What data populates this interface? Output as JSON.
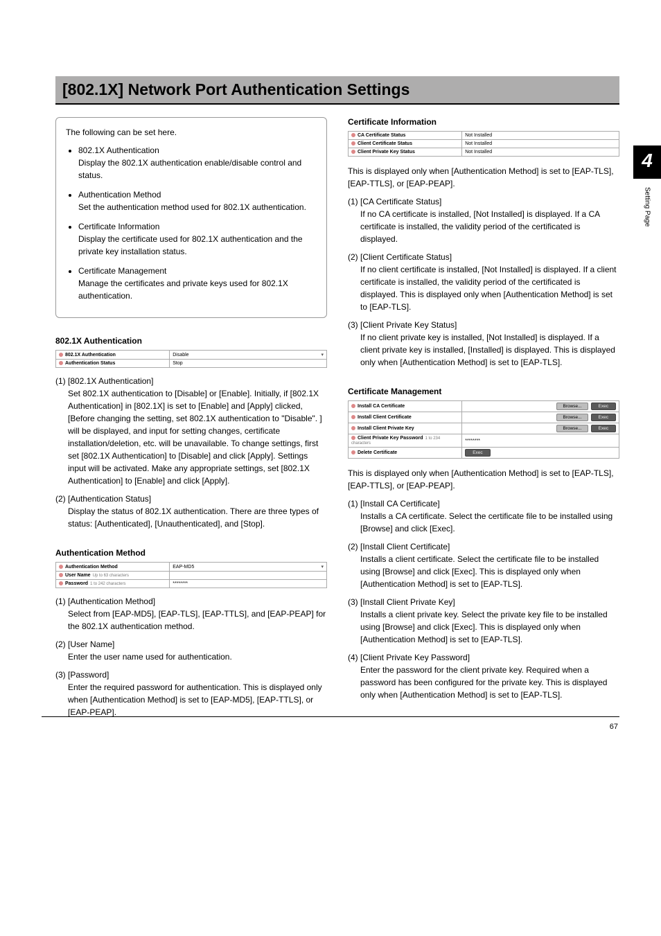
{
  "page": {
    "title": "[802.1X] Network Port Authentication Settings",
    "chapter": "4",
    "sidecap": "Setting Page",
    "pagenum": "67"
  },
  "intro": {
    "lead": "The following can be set here.",
    "items": [
      {
        "title": "802.1X Authentication",
        "body": "Display the 802.1X authentication enable/disable control and status."
      },
      {
        "title": "Authentication Method",
        "body": "Set the authentication method used for 802.1X authentication."
      },
      {
        "title": "Certificate Information",
        "body": "Display the certificate used for 802.1X authentication and the private key installation status."
      },
      {
        "title": "Certificate Management",
        "body": "Manage the certificates and private keys used for 802.1X authentication."
      }
    ]
  },
  "auth": {
    "heading": "802.1X Authentication",
    "rows": [
      {
        "label": "802.1X Authentication",
        "value": "Disable",
        "dropdown": true
      },
      {
        "label": "Authentication Status",
        "value": "Stop"
      }
    ],
    "items": [
      {
        "head": "(1) [802.1X Authentication]",
        "body": "Set 802.1X authentication to [Disable] or [Enable]. Initially, if [802.1X Authentication] in [802.1X] is set to [Enable] and [Apply] clicked, [Before changing the setting, set 802.1X authentication to \"Disable\". ] will be displayed, and input for setting changes, certificate installation/deletion, etc. will be unavailable. To change settings, first set [802.1X Authentication] to [Disable] and click [Apply]. Settings input will be activated. Make any appropriate settings, set [802.1X Authentication] to [Enable] and click [Apply]."
      },
      {
        "head": "(2) [Authentication Status]",
        "body": "Display the status of 802.1X authentication. There are three types of status: [Authenticated], [Unauthenticated], and [Stop]."
      }
    ]
  },
  "method": {
    "heading": "Authentication Method",
    "rows": [
      {
        "label": "Authentication Method",
        "value": "EAP-MD5",
        "dropdown": true
      },
      {
        "label": "User Name",
        "hint": "Up to 63 characters",
        "value": ""
      },
      {
        "label": "Password",
        "hint": "1 to 242 characters",
        "value": "********"
      }
    ],
    "items": [
      {
        "head": "(1) [Authentication Method]",
        "body": "Select from [EAP-MD5], [EAP-TLS], [EAP-TTLS], and [EAP-PEAP] for the 802.1X authentication method."
      },
      {
        "head": "(2) [User Name]",
        "body": "Enter the user name used for authentication."
      },
      {
        "head": "(3) [Password]",
        "body": "Enter the required password for authentication. This is displayed only when [Authentication Method] is set to [EAP-MD5], [EAP-TTLS], or [EAP-PEAP]."
      }
    ]
  },
  "certinfo": {
    "heading": "Certificate Information",
    "rows": [
      {
        "label": "CA Certificate Status",
        "value": "Not Installed"
      },
      {
        "label": "Client Certificate Status",
        "value": "Not Installed"
      },
      {
        "label": "Client Private Key Status",
        "value": "Not Installed"
      }
    ],
    "note": "This is displayed only when [Authentication Method] is set to [EAP-TLS], [EAP-TTLS], or [EAP-PEAP].",
    "items": [
      {
        "head": "(1) [CA Certificate Status]",
        "body": "If no CA certificate is installed, [Not Installed] is displayed. If a CA certificate is installed, the validity period of the certificated is displayed."
      },
      {
        "head": "(2) [Client Certificate Status]",
        "body": "If no client certificate is installed, [Not Installed] is displayed. If a client certificate is installed, the validity period of the certificated is displayed. This is displayed only when [Authentication Method] is set to [EAP-TLS]."
      },
      {
        "head": "(3) [Client Private Key Status]",
        "body": "If no client private key is installed, [Not Installed] is displayed. If a client private key is installed, [Installed] is displayed. This is displayed only when [Authentication Method] is set to [EAP-TLS]."
      }
    ]
  },
  "certmgmt": {
    "heading": "Certificate Management",
    "browse": "Browse...",
    "exec": "Exec",
    "rows": [
      {
        "label": "Install CA Certificate",
        "type": "browse_exec"
      },
      {
        "label": "Install Client Certificate",
        "type": "browse_exec"
      },
      {
        "label": "Install Client Private Key",
        "type": "browse_exec"
      },
      {
        "label": "Client Private Key Password",
        "hint": "1 to 234 characters",
        "value": "********",
        "type": "text"
      },
      {
        "label": "Delete Certificate",
        "type": "exec_only"
      }
    ],
    "note": "This is displayed only when [Authentication Method] is set to [EAP-TLS], [EAP-TTLS], or [EAP-PEAP].",
    "items": [
      {
        "head": "(1) [Install CA Certificate]",
        "body": "Installs a CA certificate. Select the certificate file to be installed using [Browse] and click [Exec]."
      },
      {
        "head": "(2) [Install Client Certificate]",
        "body": "Installs a client certificate. Select the certificate file to be installed using [Browse] and click [Exec]. This is displayed only when [Authentication Method] is set to [EAP-TLS]."
      },
      {
        "head": "(3) [Install Client Private Key]",
        "body": "Installs a client private key. Select the private key file to be installed using [Browse] and click [Exec]. This is displayed only when [Authentication Method] is set to [EAP-TLS]."
      },
      {
        "head": "(4) [Client Private Key Password]",
        "body": "Enter the password for the client private key. Required when a password has been configured for the private key. This is displayed only when [Authentication Method] is set to [EAP-TLS]."
      }
    ]
  }
}
